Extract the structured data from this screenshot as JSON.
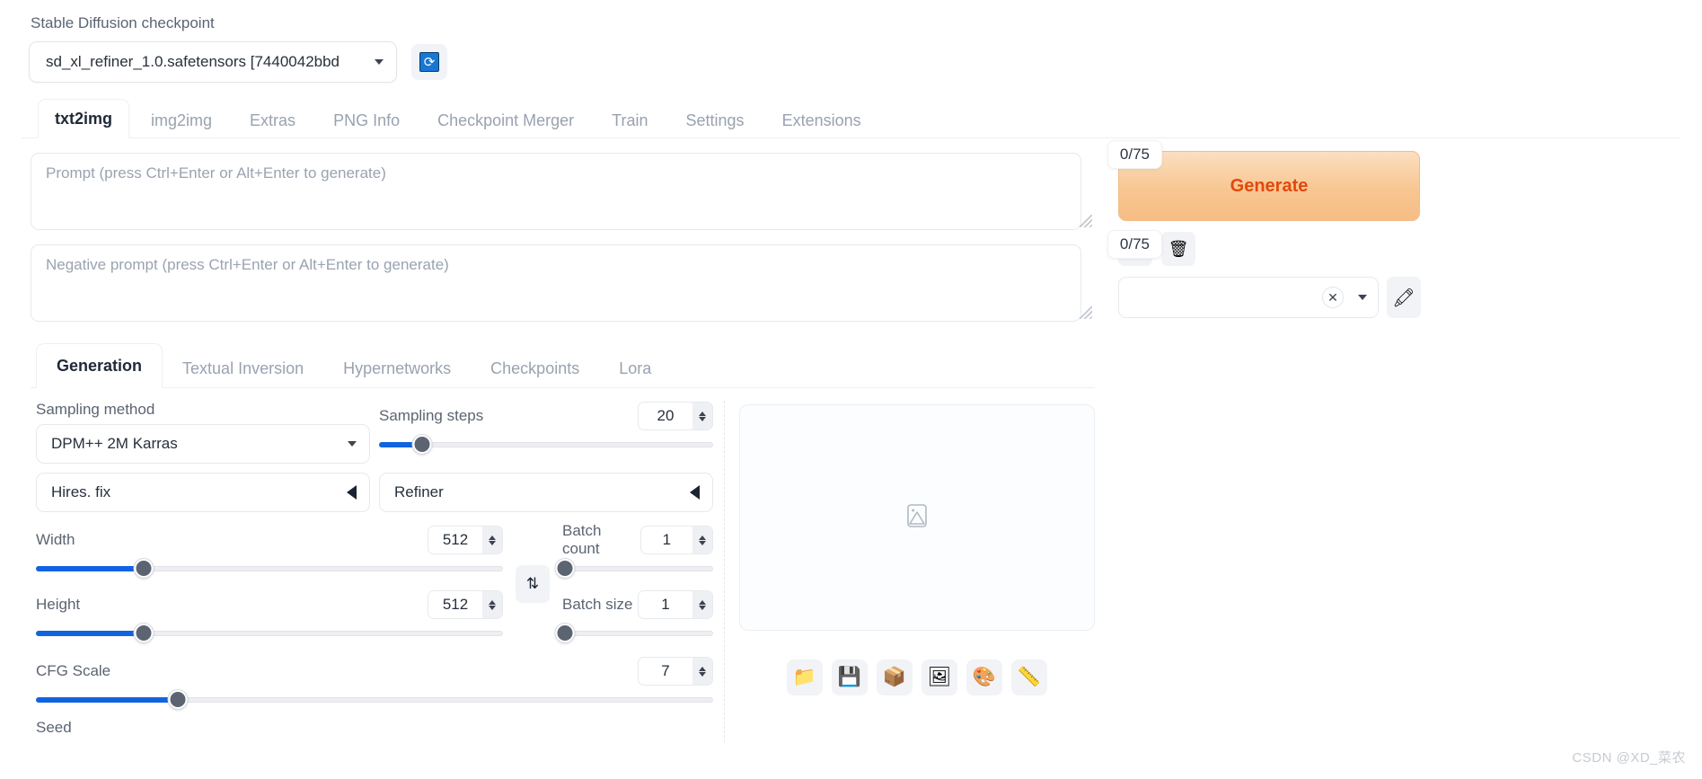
{
  "checkpoint": {
    "label": "Stable Diffusion checkpoint",
    "value": "sd_xl_refiner_1.0.safetensors [7440042bbd",
    "refresh_icon": "refresh-icon"
  },
  "main_tabs": [
    {
      "label": "txt2img",
      "active": true
    },
    {
      "label": "img2img",
      "active": false
    },
    {
      "label": "Extras",
      "active": false
    },
    {
      "label": "PNG Info",
      "active": false
    },
    {
      "label": "Checkpoint Merger",
      "active": false
    },
    {
      "label": "Train",
      "active": false
    },
    {
      "label": "Settings",
      "active": false
    },
    {
      "label": "Extensions",
      "active": false
    }
  ],
  "prompt": {
    "placeholder": "Prompt (press Ctrl+Enter or Alt+Enter to generate)",
    "value": "",
    "token_count": "0/75"
  },
  "negative_prompt": {
    "placeholder": "Negative prompt (press Ctrl+Enter or Alt+Enter to generate)",
    "value": "",
    "token_count": "0/75"
  },
  "generate": {
    "label": "Generate",
    "accent": "#e2490c"
  },
  "action_buttons": [
    {
      "name": "restore-progress-button",
      "icon": "arrow-down-left-icon"
    },
    {
      "name": "clear-prompt-button",
      "icon": "trash-icon"
    }
  ],
  "styles": {
    "value": "",
    "clear_icon": "close-icon",
    "dropdown_icon": "chevron-down-icon",
    "edit_icon": "pencil-icon"
  },
  "sub_tabs": [
    {
      "label": "Generation",
      "active": true
    },
    {
      "label": "Textual Inversion",
      "active": false
    },
    {
      "label": "Hypernetworks",
      "active": false
    },
    {
      "label": "Checkpoints",
      "active": false
    },
    {
      "label": "Lora",
      "active": false
    }
  ],
  "settings": {
    "sampling_method": {
      "label": "Sampling method",
      "value": "DPM++ 2M Karras"
    },
    "sampling_steps": {
      "label": "Sampling steps",
      "value": "20",
      "min": 1,
      "max": 150,
      "percent": 13
    },
    "hires_fix": {
      "label": "Hires. fix",
      "collapsed": true
    },
    "refiner": {
      "label": "Refiner",
      "collapsed": true
    },
    "width": {
      "label": "Width",
      "value": "512",
      "min": 64,
      "max": 2048,
      "percent": 23
    },
    "height": {
      "label": "Height",
      "value": "512",
      "min": 64,
      "max": 2048,
      "percent": 23
    },
    "batch_count": {
      "label": "Batch count",
      "value": "1",
      "min": 1,
      "max": 100,
      "percent": 1
    },
    "batch_size": {
      "label": "Batch size",
      "value": "1",
      "min": 1,
      "max": 8,
      "percent": 1
    },
    "cfg_scale": {
      "label": "CFG Scale",
      "value": "7",
      "min": 1,
      "max": 30,
      "percent": 21
    },
    "seed": {
      "label": "Seed"
    },
    "swap_icon": "swap-dimensions-icon"
  },
  "output": {
    "placeholder_icon": "image-placeholder-icon",
    "toolbar": [
      {
        "name": "open-folder-button",
        "icon": "folder-icon"
      },
      {
        "name": "save-button",
        "icon": "floppy-disk-icon"
      },
      {
        "name": "zip-button",
        "icon": "archive-box-icon"
      },
      {
        "name": "send-to-img2img-button",
        "icon": "picture-icon"
      },
      {
        "name": "send-to-inpaint-button",
        "icon": "palette-icon"
      },
      {
        "name": "send-to-extras-button",
        "icon": "ruler-icon"
      }
    ]
  },
  "watermark": "CSDN @XD_菜农"
}
